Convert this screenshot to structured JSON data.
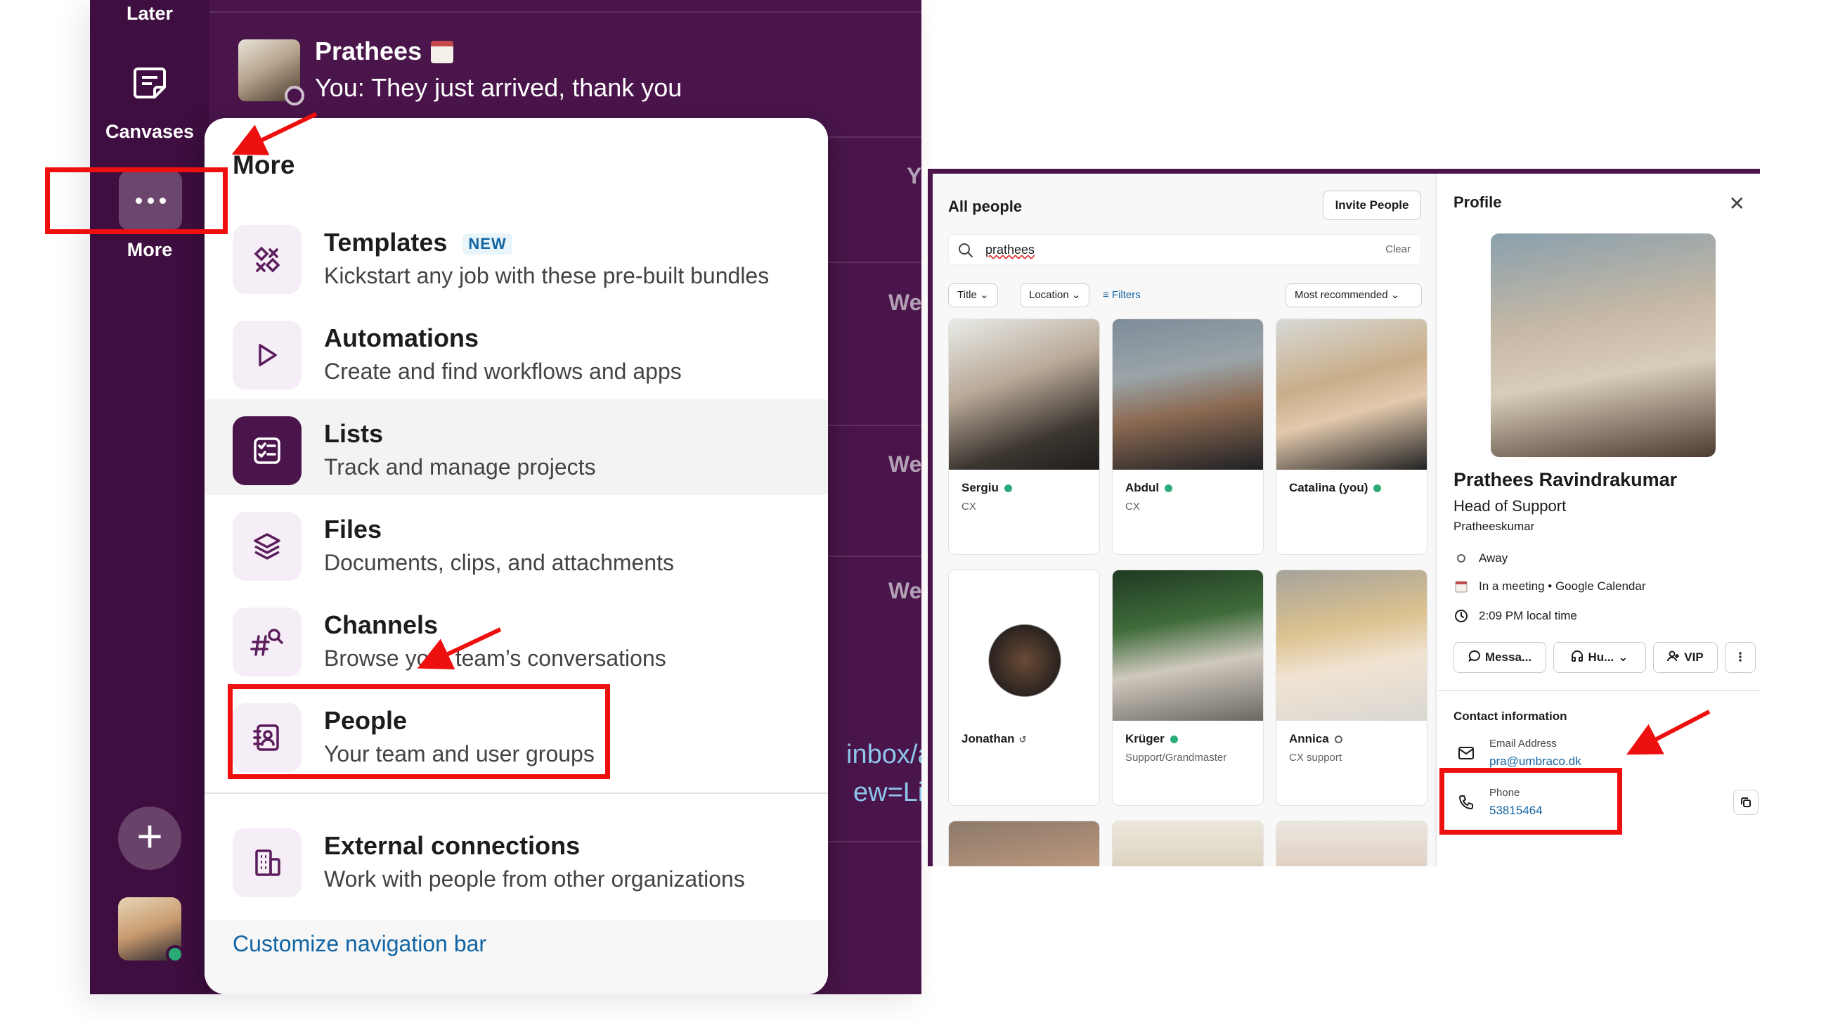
{
  "left": {
    "rail": {
      "later_label": "Later",
      "canvases_label": "Canvases",
      "more_label": "More"
    },
    "dm": {
      "name": "Prathees",
      "preview": "You: They just arrived, thank you"
    },
    "peek_texts": [
      "Y",
      "We",
      "We",
      "We"
    ],
    "peek_links": [
      "inbox/ac",
      "ew=List"
    ],
    "more_menu": {
      "title": "More",
      "items": [
        {
          "title": "Templates",
          "badge": "NEW",
          "desc": "Kickstart any job with these pre-built bundles",
          "icon": "templates-icon"
        },
        {
          "title": "Automations",
          "desc": "Create and find workflows and apps",
          "icon": "play-icon"
        },
        {
          "title": "Lists",
          "desc": "Track and manage projects",
          "icon": "list-icon"
        },
        {
          "title": "Files",
          "desc": "Documents, clips, and attachments",
          "icon": "layers-icon"
        },
        {
          "title": "Channels",
          "desc": "Browse your team’s conversations",
          "icon": "channel-search-icon"
        },
        {
          "title": "People",
          "desc": "Your team and user groups",
          "icon": "contact-book-icon"
        },
        {
          "title": "External connections",
          "desc": "Work with people from other organizations",
          "icon": "building-icon"
        }
      ],
      "customize_label": "Customize navigation bar"
    }
  },
  "right": {
    "people": {
      "title": "All people",
      "invite_label": "Invite People",
      "search_value": "prathees",
      "clear_label": "Clear",
      "filter_title": "Title",
      "filter_location": "Location",
      "filters_label": "Filters",
      "sort_label": "Most recommended",
      "cards": [
        {
          "name": "Sergiu",
          "title": "CX",
          "status": "active"
        },
        {
          "name": "Abdul",
          "title": "CX",
          "status": "active"
        },
        {
          "name": "Catalina (you)",
          "title": "",
          "status": "active"
        },
        {
          "name": "Jonathan",
          "title": "",
          "status": "dnd"
        },
        {
          "name": "Krüger",
          "title": "Support/Grandmaster",
          "status": "active"
        },
        {
          "name": "Annica",
          "title": "CX support",
          "status": "away"
        }
      ]
    },
    "profile": {
      "title": "Profile",
      "name": "Prathees Ravindrakumar",
      "role": "Head of Support",
      "handle": "Pratheeskumar",
      "status": "Away",
      "meeting": "In a meeting • Google Calendar",
      "local_time": "2:09 PM local time",
      "btn_message": "Messa...",
      "btn_huddle": "Hu...",
      "btn_vip": "VIP",
      "contact_title": "Contact information",
      "email_label": "Email Address",
      "email_value": "pra@umbraco.dk",
      "phone_label": "Phone",
      "phone_value": "53815464"
    }
  },
  "colors": {
    "aubergine": "#4a154b",
    "rail": "#3f0e40",
    "link": "#1264a3",
    "annotation_red": "#ee0f0f",
    "online_green": "#2bac76"
  }
}
